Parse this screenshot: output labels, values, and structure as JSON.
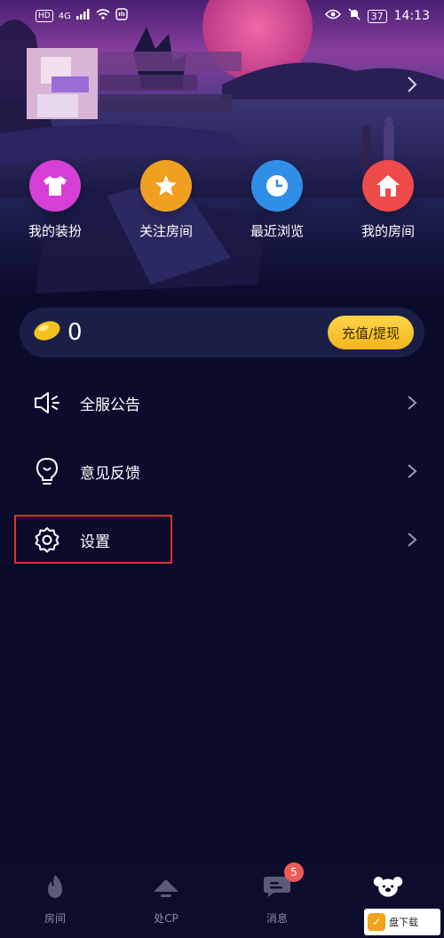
{
  "status_bar": {
    "hd": "HD",
    "network": "4G",
    "battery": "37",
    "time": "14:13"
  },
  "shortcuts": [
    {
      "label": "我的装扮",
      "icon": "shirt-icon",
      "color": "#d63fd6"
    },
    {
      "label": "关注房间",
      "icon": "star-icon",
      "color": "#f0a020"
    },
    {
      "label": "最近浏览",
      "icon": "clock-icon",
      "color": "#2f8ee8"
    },
    {
      "label": "我的房间",
      "icon": "home-icon",
      "color": "#ef4a4a"
    }
  ],
  "wallet": {
    "amount": "0",
    "recharge_label": "充值/提现"
  },
  "menu": [
    {
      "label": "全服公告",
      "icon": "speaker-icon"
    },
    {
      "label": "意见反馈",
      "icon": "lightbulb-icon"
    },
    {
      "label": "设置",
      "icon": "gear-icon"
    }
  ],
  "bottom_nav": [
    {
      "label": "房间",
      "icon": "flame-icon"
    },
    {
      "label": "处CP",
      "icon": "cp-icon"
    },
    {
      "label": "消息",
      "icon": "chat-icon"
    },
    {
      "label": "",
      "icon": "koala-icon"
    }
  ],
  "message_badge": "5",
  "watermark": {
    "text": "盘下载"
  }
}
